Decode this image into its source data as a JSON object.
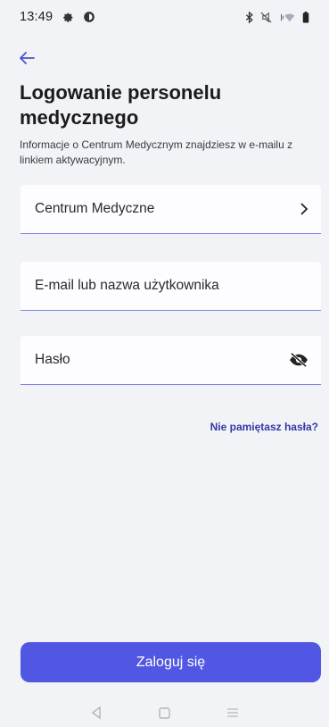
{
  "status_bar": {
    "time": "13:49",
    "left_icons": [
      "gear-icon",
      "vpn-icon"
    ],
    "right_icons": [
      "bluetooth-icon",
      "mute-icon",
      "wifi-icon",
      "battery-icon"
    ]
  },
  "header": {
    "back_icon": "arrow-left-icon",
    "title": "Logowanie personelu medycznego",
    "subtitle": "Informacje o Centrum Medycznym znajdziesz w e-mailu z linkiem aktywacyjnym."
  },
  "form": {
    "medical_center": {
      "label": "Centrum Medyczne",
      "icon": "chevron-right-icon"
    },
    "username": {
      "label": "E-mail lub nazwa użytkownika"
    },
    "password": {
      "label": "Hasło",
      "icon": "eye-off-icon"
    },
    "forgot_password": "Nie pamiętasz hasła?",
    "submit": "Zaloguj się"
  },
  "colors": {
    "accent": "#5157e3",
    "link": "#3437a8",
    "field_underline": "#7b84ea",
    "background": "#f2f3f7"
  },
  "nav_bar": {
    "icons": [
      "nav-back-icon",
      "nav-home-icon",
      "nav-menu-icon"
    ]
  }
}
